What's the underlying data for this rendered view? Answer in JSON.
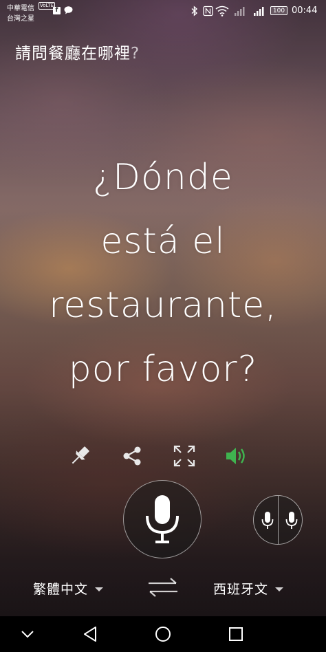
{
  "status_bar": {
    "carrier_line1": "中華電信",
    "carrier_line2": "台灣之星",
    "volte_badge": "VoLTE",
    "fb_badge": "f",
    "battery": "100",
    "time": "00:44",
    "icons": [
      "facebook-icon",
      "messenger-icon",
      "bluetooth-icon",
      "nfc-icon",
      "wifi-icon",
      "signal-icon",
      "signal-icon",
      "battery-icon"
    ]
  },
  "source": {
    "text": "請問餐廳在哪裡",
    "question_mark": "?"
  },
  "translation": {
    "lines": [
      "¿Dónde",
      "está el",
      "restaurante,",
      "por favor?"
    ]
  },
  "actions": {
    "icons": [
      "pin-icon",
      "share-icon",
      "fullscreen-icon",
      "speaker-icon"
    ],
    "speaker_color": "#3fb34f"
  },
  "languages": {
    "source": "繁體中文",
    "target": "西班牙文"
  },
  "nav": {
    "icons": [
      "chevron-down-icon",
      "back-icon",
      "home-icon",
      "recents-icon"
    ]
  }
}
